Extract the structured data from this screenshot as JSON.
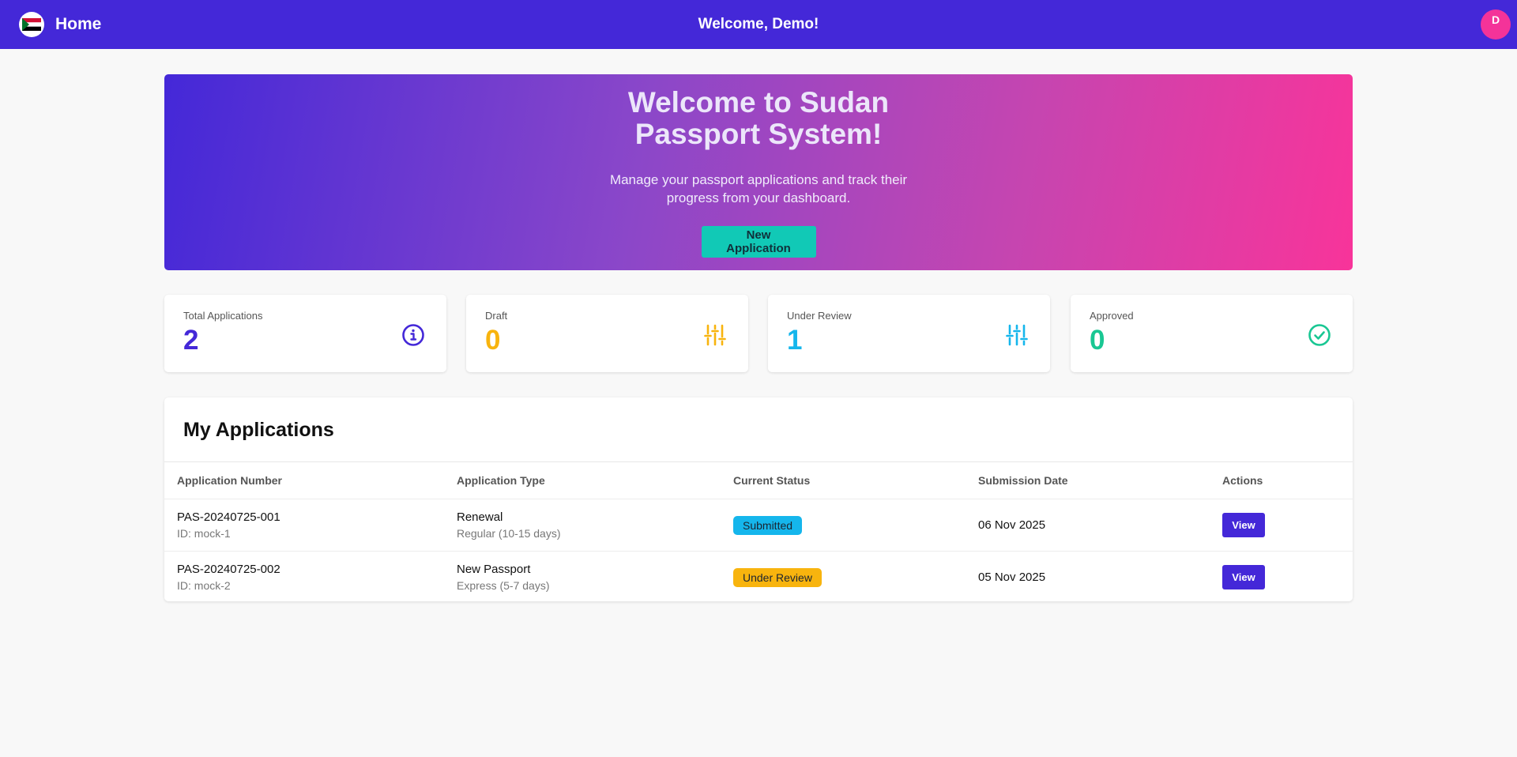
{
  "navbar": {
    "title": "Home",
    "welcome": "Welcome, Demo!",
    "avatar_initial": "D"
  },
  "hero": {
    "title": "Welcome to Sudan Passport System!",
    "subtitle": "Manage your passport applications and track their progress from your dashboard.",
    "button_label": "New Application"
  },
  "stats": [
    {
      "label": "Total Applications",
      "value": "2",
      "color": "#4428d8",
      "icon": "info-circle-icon"
    },
    {
      "label": "Draft",
      "value": "0",
      "color": "#f8b40e",
      "icon": "sliders-icon"
    },
    {
      "label": "Under Review",
      "value": "1",
      "color": "#15b6ec",
      "icon": "sliders-icon"
    },
    {
      "label": "Approved",
      "value": "0",
      "color": "#19c793",
      "icon": "check-circle-icon"
    }
  ],
  "applications": {
    "title": "My Applications",
    "columns": [
      "Application Number",
      "Application Type",
      "Current Status",
      "Submission Date",
      "Actions"
    ],
    "rows": [
      {
        "number": "PAS-20240725-001",
        "id": "ID: mock-1",
        "type": "Renewal",
        "speed": "Regular (10-15 days)",
        "status": "Submitted",
        "status_color": "#15b6ec",
        "date": "06 Nov 2025",
        "action": "View"
      },
      {
        "number": "PAS-20240725-002",
        "id": "ID: mock-2",
        "type": "New Passport",
        "speed": "Express (5-7 days)",
        "status": "Under Review",
        "status_color": "#f8b40e",
        "date": "05 Nov 2025",
        "action": "View"
      }
    ]
  }
}
